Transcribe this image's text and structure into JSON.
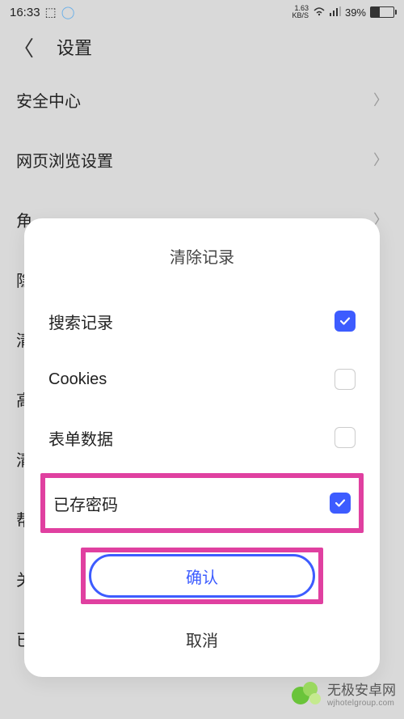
{
  "status": {
    "time": "16:33",
    "network_rate_top": "1.63",
    "network_rate_bottom": "KB/S",
    "battery_pct": "39%"
  },
  "header": {
    "title": "设置"
  },
  "settings": {
    "items": [
      {
        "label": "安全中心"
      },
      {
        "label": "网页浏览设置"
      },
      {
        "label": "角"
      },
      {
        "label": "隐"
      },
      {
        "label": "清"
      },
      {
        "label": "高"
      },
      {
        "label": "清"
      },
      {
        "label": "帮"
      },
      {
        "label": "关"
      },
      {
        "label": "已"
      }
    ]
  },
  "modal": {
    "title": "清除记录",
    "options": [
      {
        "label": "搜索记录",
        "checked": true,
        "highlighted": false
      },
      {
        "label": "Cookies",
        "checked": false,
        "highlighted": false
      },
      {
        "label": "表单数据",
        "checked": false,
        "highlighted": false
      },
      {
        "label": "已存密码",
        "checked": true,
        "highlighted": true
      }
    ],
    "confirm": "确认",
    "cancel": "取消"
  },
  "watermark": {
    "cn": "无极安卓网",
    "en": "wjhotelgroup.com"
  }
}
